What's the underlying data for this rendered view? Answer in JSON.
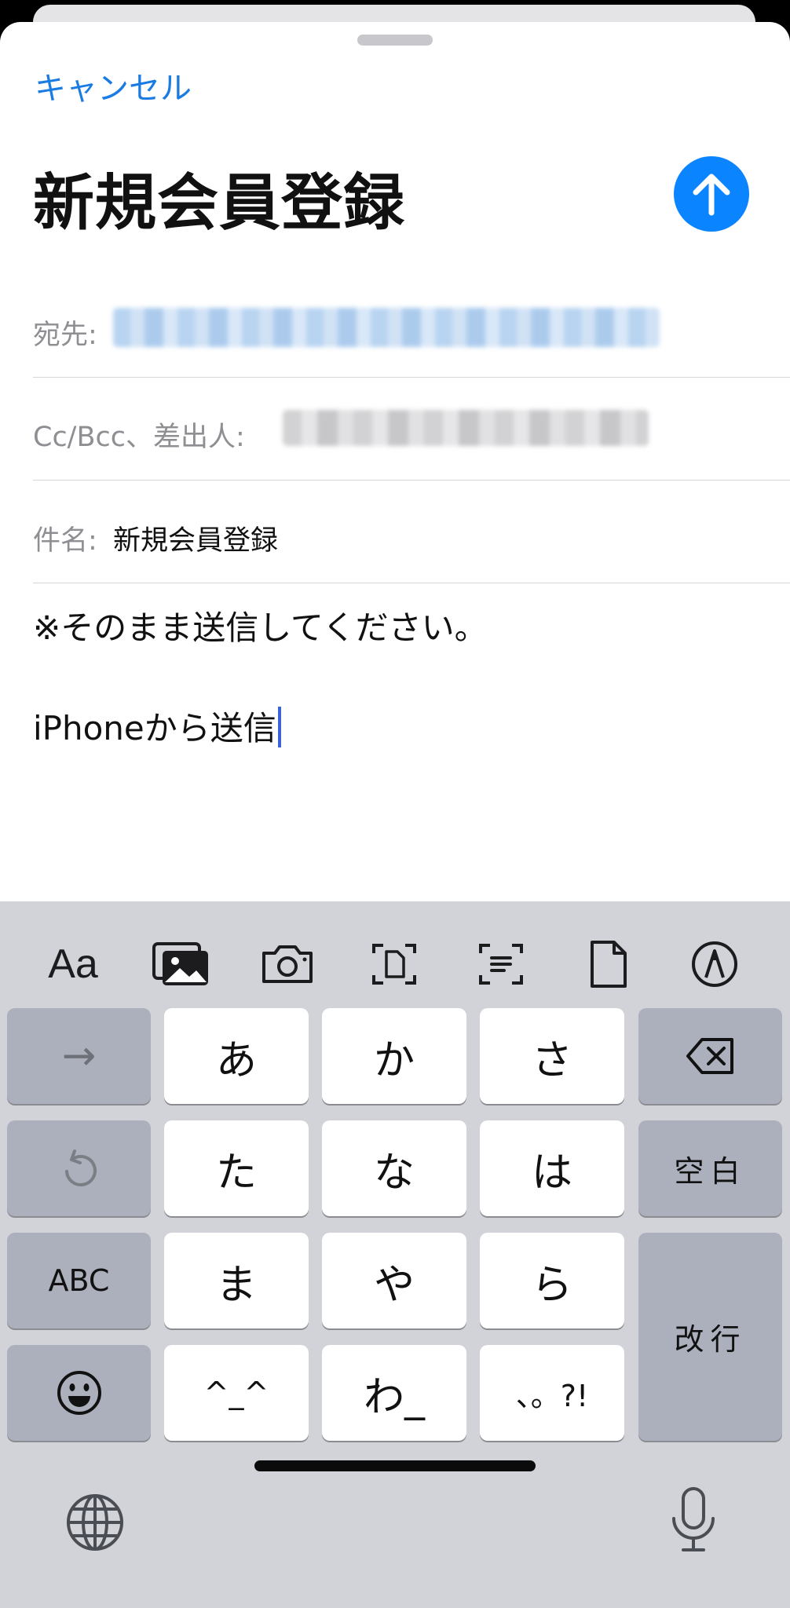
{
  "header": {
    "cancel_label": "キャンセル",
    "title": "新規会員登録"
  },
  "fields": {
    "to_label": "宛先:",
    "cc_label": "Cc/Bcc、差出人:",
    "subject_label": "件名:",
    "subject_value": "新規会員登録"
  },
  "body": {
    "line1": "※そのまま送信してください。",
    "line2": "iPhoneから送信"
  },
  "toolbar": {
    "format_label": "Aa",
    "icons": [
      "photo-library-icon",
      "camera-icon",
      "scan-document-icon",
      "scan-text-icon",
      "document-icon",
      "markup-icon"
    ]
  },
  "keyboard": {
    "keys": {
      "next": "→",
      "a": "あ",
      "ka": "か",
      "sa": "さ",
      "ta": "た",
      "na": "な",
      "ha": "は",
      "space": "空白",
      "abc": "ABC",
      "ma": "ま",
      "ya": "や",
      "ra": "ら",
      "return": "改行",
      "kaomoji": "^_^",
      "wa": "わ_",
      "punct": "、。?!"
    }
  },
  "colors": {
    "accent": "#1a7be3",
    "send_button": "#0a84ff",
    "keyboard_bg": "#d1d3d9"
  }
}
